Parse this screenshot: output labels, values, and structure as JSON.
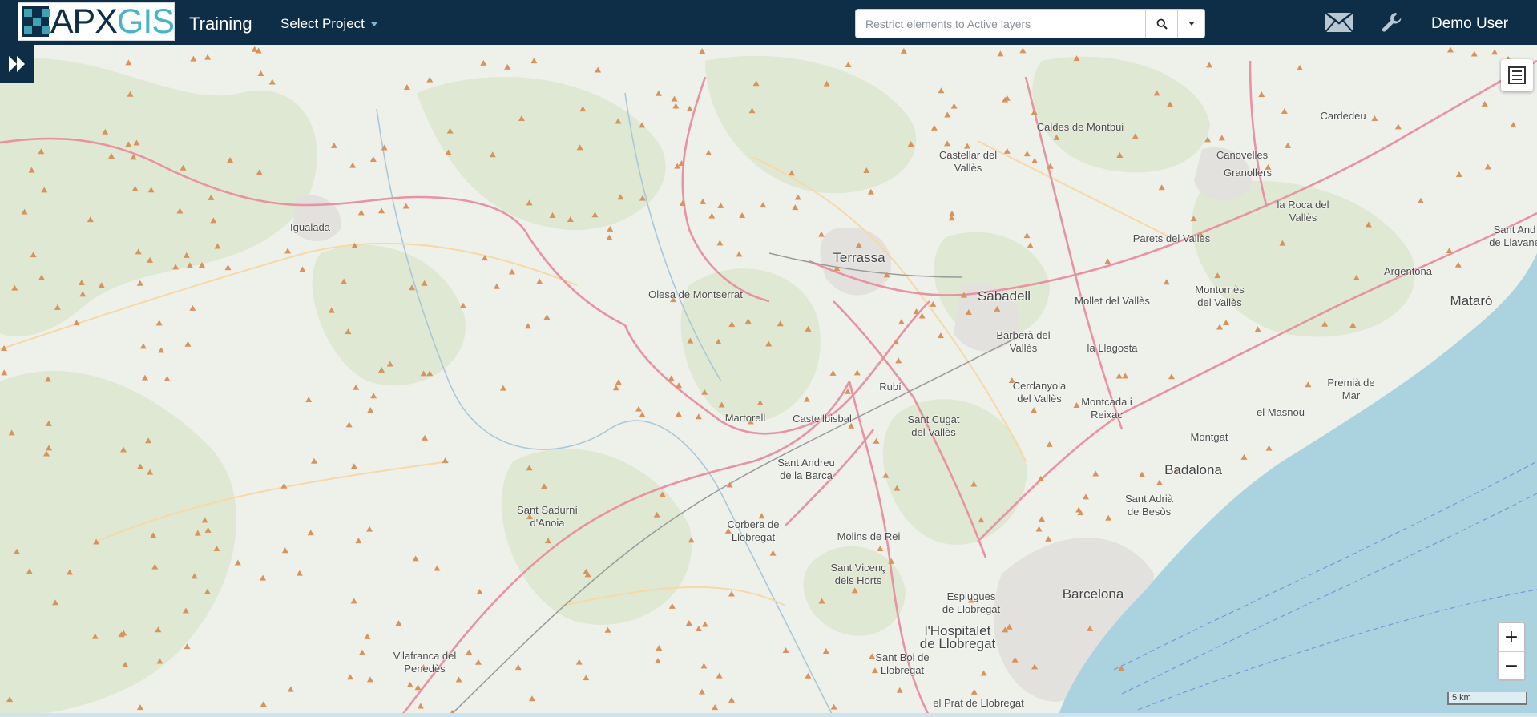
{
  "navbar": {
    "logo": {
      "prefix": "APX",
      "suffix": "GIS"
    },
    "title": "Training",
    "project_select": "Select Project",
    "search": {
      "placeholder": "Restrict elements to Active layers"
    },
    "user": "Demo User"
  },
  "colors": {
    "navbar_bg": "#0e2e47",
    "logo_accent": "#49b4c8",
    "map_land": "#eef0ea",
    "map_forest": "#dfe8d3",
    "map_sea": "#aad3df",
    "road_major": "#e892a2",
    "peak": "#d9925b"
  },
  "icons": {
    "sidebar_toggle": "double-chevron-right-icon",
    "search": "search-icon",
    "mail": "envelope-icon",
    "tools": "wrench-icon",
    "legend": "list-icon"
  },
  "map": {
    "zoom_in": "+",
    "zoom_out": "−",
    "scale": "5 km",
    "places": [
      {
        "name": "Igualada"
      },
      {
        "name": "Olesa de Montserrat"
      },
      {
        "name": "Terrassa"
      },
      {
        "name": "Sabadell"
      },
      {
        "name": "Castellar del\nVallès"
      },
      {
        "name": "Caldes de Montbui"
      },
      {
        "name": "Cardedeu"
      },
      {
        "name": "Canovelles"
      },
      {
        "name": "Granollers"
      },
      {
        "name": "la Roca del\nVallès"
      },
      {
        "name": "Parets del Vallès"
      },
      {
        "name": "Montornès\ndel Vallès"
      },
      {
        "name": "Mollet del Vallès"
      },
      {
        "name": "la Llagosta"
      },
      {
        "name": "Argentona"
      },
      {
        "name": "Mataró"
      },
      {
        "name": "Sant And\nde Llavane"
      },
      {
        "name": "Barberà del\nVallès"
      },
      {
        "name": "Cerdanyola\ndel Vallès"
      },
      {
        "name": "Montcada i\nReixac"
      },
      {
        "name": "Premià de\nMar"
      },
      {
        "name": "el Masnou"
      },
      {
        "name": "Montgat"
      },
      {
        "name": "Badalona"
      },
      {
        "name": "Rubí"
      },
      {
        "name": "Sant Cugat\ndel Vallès"
      },
      {
        "name": "Martorell"
      },
      {
        "name": "Castellbisbal"
      },
      {
        "name": "Sant Andreu\nde la Barca"
      },
      {
        "name": "Sant Sadurní\nd'Anoia"
      },
      {
        "name": "Corbera de\nLlobregat"
      },
      {
        "name": "Molins de Rei"
      },
      {
        "name": "Sant Vicenç\ndels Horts"
      },
      {
        "name": "Sant Adrià\nde Besòs"
      },
      {
        "name": "Barcelona"
      },
      {
        "name": "Esplugues\nde Llobregat"
      },
      {
        "name": "l'Hospitalet\nde Llobregat"
      },
      {
        "name": "Sant Boi de\nLlobregat"
      },
      {
        "name": "Vilafranca del\nPenedès"
      },
      {
        "name": "el Prat de Llobregat"
      }
    ]
  }
}
